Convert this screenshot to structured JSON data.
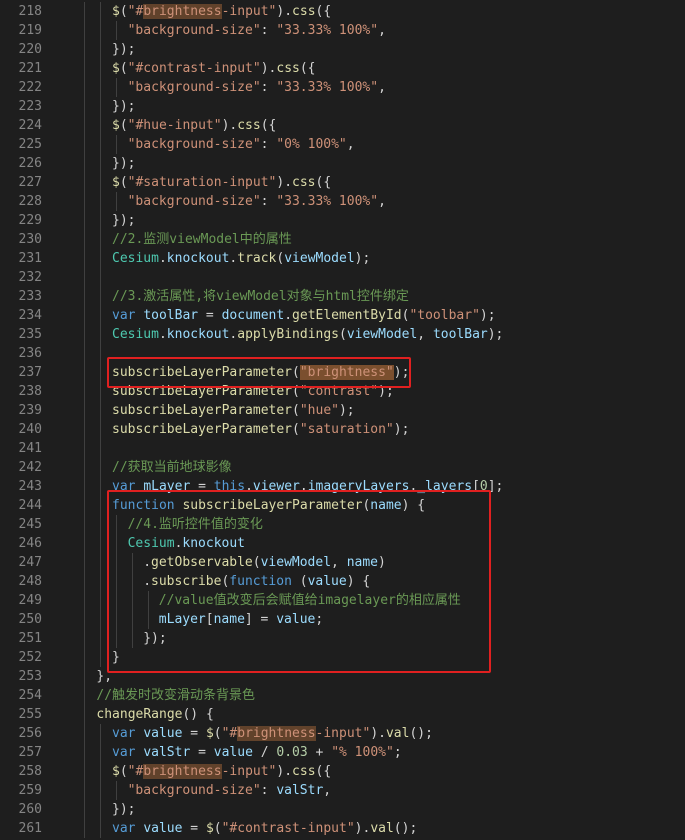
{
  "editor": {
    "lines": [
      {
        "n": "218",
        "d": 2,
        "t": [
          [
            "$",
            "fn"
          ],
          [
            "(",
            "pn"
          ],
          [
            "\"#",
            "str"
          ],
          [
            "brightness",
            "strhl"
          ],
          [
            "-input\"",
            "str"
          ],
          [
            ").",
            "pn"
          ],
          [
            "css",
            "fn"
          ],
          [
            "({",
            "pn"
          ]
        ]
      },
      {
        "n": "219",
        "d": 3,
        "t": [
          [
            "\"background-size\"",
            "str"
          ],
          [
            ": ",
            "pn"
          ],
          [
            "\"33.33% 100%\"",
            "str"
          ],
          [
            ",",
            "pn"
          ]
        ]
      },
      {
        "n": "220",
        "d": 2,
        "t": [
          [
            "});",
            "pn"
          ]
        ]
      },
      {
        "n": "221",
        "d": 2,
        "t": [
          [
            "$",
            "fn"
          ],
          [
            "(",
            "pn"
          ],
          [
            "\"#contrast-input\"",
            "str"
          ],
          [
            ").",
            "pn"
          ],
          [
            "css",
            "fn"
          ],
          [
            "({",
            "pn"
          ]
        ]
      },
      {
        "n": "222",
        "d": 3,
        "t": [
          [
            "\"background-size\"",
            "str"
          ],
          [
            ": ",
            "pn"
          ],
          [
            "\"33.33% 100%\"",
            "str"
          ],
          [
            ",",
            "pn"
          ]
        ]
      },
      {
        "n": "223",
        "d": 2,
        "t": [
          [
            "});",
            "pn"
          ]
        ]
      },
      {
        "n": "224",
        "d": 2,
        "t": [
          [
            "$",
            "fn"
          ],
          [
            "(",
            "pn"
          ],
          [
            "\"#hue-input\"",
            "str"
          ],
          [
            ").",
            "pn"
          ],
          [
            "css",
            "fn"
          ],
          [
            "({",
            "pn"
          ]
        ]
      },
      {
        "n": "225",
        "d": 3,
        "t": [
          [
            "\"background-size\"",
            "str"
          ],
          [
            ": ",
            "pn"
          ],
          [
            "\"0% 100%\"",
            "str"
          ],
          [
            ",",
            "pn"
          ]
        ]
      },
      {
        "n": "226",
        "d": 2,
        "t": [
          [
            "});",
            "pn"
          ]
        ]
      },
      {
        "n": "227",
        "d": 2,
        "t": [
          [
            "$",
            "fn"
          ],
          [
            "(",
            "pn"
          ],
          [
            "\"#saturation-input\"",
            "str"
          ],
          [
            ").",
            "pn"
          ],
          [
            "css",
            "fn"
          ],
          [
            "({",
            "pn"
          ]
        ]
      },
      {
        "n": "228",
        "d": 3,
        "t": [
          [
            "\"background-size\"",
            "str"
          ],
          [
            ": ",
            "pn"
          ],
          [
            "\"33.33% 100%\"",
            "str"
          ],
          [
            ",",
            "pn"
          ]
        ]
      },
      {
        "n": "229",
        "d": 2,
        "t": [
          [
            "});",
            "pn"
          ]
        ]
      },
      {
        "n": "230",
        "d": 2,
        "t": [
          [
            "//2.监测viewModel中的属性",
            "cm"
          ]
        ]
      },
      {
        "n": "231",
        "d": 2,
        "t": [
          [
            "Cesium",
            "type"
          ],
          [
            ".",
            "pn"
          ],
          [
            "knockout",
            "var"
          ],
          [
            ".",
            "pn"
          ],
          [
            "track",
            "fn"
          ],
          [
            "(",
            "pn"
          ],
          [
            "viewModel",
            "var"
          ],
          [
            ");",
            "pn"
          ]
        ]
      },
      {
        "n": "232",
        "d": 2,
        "t": []
      },
      {
        "n": "233",
        "d": 2,
        "t": [
          [
            "//3.激活属性,将viewModel对象与html控件绑定",
            "cm"
          ]
        ]
      },
      {
        "n": "234",
        "d": 2,
        "t": [
          [
            "var ",
            "kw"
          ],
          [
            "toolBar",
            "var"
          ],
          [
            " = ",
            "pn"
          ],
          [
            "document",
            "var"
          ],
          [
            ".",
            "pn"
          ],
          [
            "getElementById",
            "fn"
          ],
          [
            "(",
            "pn"
          ],
          [
            "\"toolbar\"",
            "str"
          ],
          [
            ");",
            "pn"
          ]
        ]
      },
      {
        "n": "235",
        "d": 2,
        "t": [
          [
            "Cesium",
            "type"
          ],
          [
            ".",
            "pn"
          ],
          [
            "knockout",
            "var"
          ],
          [
            ".",
            "pn"
          ],
          [
            "applyBindings",
            "fn"
          ],
          [
            "(",
            "pn"
          ],
          [
            "viewModel",
            "var"
          ],
          [
            ", ",
            "pn"
          ],
          [
            "toolBar",
            "var"
          ],
          [
            ");",
            "pn"
          ]
        ]
      },
      {
        "n": "236",
        "d": 2,
        "t": []
      },
      {
        "n": "237",
        "d": 2,
        "t": [
          [
            "subscribeLayerParameter",
            "fn"
          ],
          [
            "(",
            "pn"
          ],
          [
            "\"brightness\"",
            "strhl2"
          ],
          [
            ");",
            "pn"
          ]
        ]
      },
      {
        "n": "238",
        "d": 2,
        "t": [
          [
            "subscribeLayerParameter",
            "fn"
          ],
          [
            "(",
            "pn"
          ],
          [
            "\"contrast\"",
            "str"
          ],
          [
            ");",
            "pn"
          ]
        ]
      },
      {
        "n": "239",
        "d": 2,
        "t": [
          [
            "subscribeLayerParameter",
            "fn"
          ],
          [
            "(",
            "pn"
          ],
          [
            "\"hue\"",
            "str"
          ],
          [
            ");",
            "pn"
          ]
        ]
      },
      {
        "n": "240",
        "d": 2,
        "t": [
          [
            "subscribeLayerParameter",
            "fn"
          ],
          [
            "(",
            "pn"
          ],
          [
            "\"saturation\"",
            "str"
          ],
          [
            ");",
            "pn"
          ]
        ]
      },
      {
        "n": "241",
        "d": 2,
        "t": []
      },
      {
        "n": "242",
        "d": 2,
        "t": [
          [
            "//获取当前地球影像",
            "cm"
          ]
        ]
      },
      {
        "n": "243",
        "d": 2,
        "t": [
          [
            "var ",
            "kw"
          ],
          [
            "mLayer",
            "var"
          ],
          [
            " = ",
            "pn"
          ],
          [
            "this",
            "kw"
          ],
          [
            ".",
            "pn"
          ],
          [
            "viewer",
            "var"
          ],
          [
            ".",
            "pn"
          ],
          [
            "imageryLayers",
            "var"
          ],
          [
            ".",
            "pn"
          ],
          [
            "_layers",
            "var"
          ],
          [
            "[",
            "pn"
          ],
          [
            "0",
            "num"
          ],
          [
            "];",
            "pn"
          ]
        ]
      },
      {
        "n": "244",
        "d": 2,
        "t": [
          [
            "function ",
            "kw"
          ],
          [
            "subscribeLayerParameter",
            "fn"
          ],
          [
            "(",
            "pn"
          ],
          [
            "name",
            "var"
          ],
          [
            ") {",
            "pn"
          ]
        ]
      },
      {
        "n": "245",
        "d": 3,
        "t": [
          [
            "//4.监听控件值的变化",
            "cm"
          ]
        ]
      },
      {
        "n": "246",
        "d": 3,
        "t": [
          [
            "Cesium",
            "type"
          ],
          [
            ".",
            "pn"
          ],
          [
            "knockout",
            "var"
          ]
        ]
      },
      {
        "n": "247",
        "d": 4,
        "t": [
          [
            ".",
            "pn"
          ],
          [
            "getObservable",
            "fn"
          ],
          [
            "(",
            "pn"
          ],
          [
            "viewModel",
            "var"
          ],
          [
            ", ",
            "pn"
          ],
          [
            "name",
            "var"
          ],
          [
            ")",
            "pn"
          ]
        ]
      },
      {
        "n": "248",
        "d": 4,
        "t": [
          [
            ".",
            "pn"
          ],
          [
            "subscribe",
            "fn"
          ],
          [
            "(",
            "pn"
          ],
          [
            "function ",
            "kw"
          ],
          [
            "(",
            "pn"
          ],
          [
            "value",
            "var"
          ],
          [
            ") {",
            "pn"
          ]
        ]
      },
      {
        "n": "249",
        "d": 5,
        "t": [
          [
            "//value值改变后会赋值给imagelayer的相应属性",
            "cm"
          ]
        ]
      },
      {
        "n": "250",
        "d": 5,
        "t": [
          [
            "mLayer",
            "var"
          ],
          [
            "[",
            "pn"
          ],
          [
            "name",
            "var"
          ],
          [
            "] = ",
            "pn"
          ],
          [
            "value",
            "var"
          ],
          [
            ";",
            "pn"
          ]
        ]
      },
      {
        "n": "251",
        "d": 4,
        "t": [
          [
            "});",
            "pn"
          ]
        ]
      },
      {
        "n": "252",
        "d": 2,
        "t": [
          [
            "}",
            "pn"
          ]
        ]
      },
      {
        "n": "253",
        "d": 1,
        "t": [
          [
            "},",
            "pn"
          ]
        ]
      },
      {
        "n": "254",
        "d": 1,
        "t": [
          [
            "//触发时改变滑动条背景色",
            "cm"
          ]
        ]
      },
      {
        "n": "255",
        "d": 1,
        "t": [
          [
            "changeRange",
            "fn"
          ],
          [
            "() {",
            "pn"
          ]
        ]
      },
      {
        "n": "256",
        "d": 2,
        "t": [
          [
            "var ",
            "kw"
          ],
          [
            "value",
            "var"
          ],
          [
            " = ",
            "pn"
          ],
          [
            "$",
            "fn"
          ],
          [
            "(",
            "pn"
          ],
          [
            "\"#",
            "str"
          ],
          [
            "brightness",
            "strhl"
          ],
          [
            "-input\"",
            "str"
          ],
          [
            ").",
            "pn"
          ],
          [
            "val",
            "fn"
          ],
          [
            "();",
            "pn"
          ]
        ]
      },
      {
        "n": "257",
        "d": 2,
        "t": [
          [
            "var ",
            "kw"
          ],
          [
            "valStr",
            "var"
          ],
          [
            " = ",
            "pn"
          ],
          [
            "value",
            "var"
          ],
          [
            " / ",
            "pn"
          ],
          [
            "0.03",
            "num"
          ],
          [
            " + ",
            "pn"
          ],
          [
            "\"% 100%\"",
            "str"
          ],
          [
            ";",
            "pn"
          ]
        ]
      },
      {
        "n": "258",
        "d": 2,
        "t": [
          [
            "$",
            "fn"
          ],
          [
            "(",
            "pn"
          ],
          [
            "\"#",
            "str"
          ],
          [
            "brightness",
            "strhl"
          ],
          [
            "-input\"",
            "str"
          ],
          [
            ").",
            "pn"
          ],
          [
            "css",
            "fn"
          ],
          [
            "({",
            "pn"
          ]
        ]
      },
      {
        "n": "259",
        "d": 3,
        "t": [
          [
            "\"background-size\"",
            "str"
          ],
          [
            ": ",
            "pn"
          ],
          [
            "valStr",
            "var"
          ],
          [
            ",",
            "pn"
          ]
        ]
      },
      {
        "n": "260",
        "d": 2,
        "t": [
          [
            "});",
            "pn"
          ]
        ]
      },
      {
        "n": "261",
        "d": 2,
        "t": [
          [
            "var ",
            "kw"
          ],
          [
            "value",
            "var"
          ],
          [
            " = ",
            "pn"
          ],
          [
            "$",
            "fn"
          ],
          [
            "(",
            "pn"
          ],
          [
            "\"#contrast-input\"",
            "str"
          ],
          [
            ").",
            "pn"
          ],
          [
            "val",
            "fn"
          ],
          [
            "();",
            "pn"
          ]
        ]
      }
    ]
  },
  "colors": {
    "background": "#1e1e1e",
    "line_number": "#858585",
    "keyword": "#569cd6",
    "string": "#ce9178",
    "variable": "#9cdcfe",
    "function": "#dcdcaa",
    "type": "#4ec9b0",
    "number": "#b5cea8",
    "comment": "#6a9955",
    "highlight_box": "#e02020"
  }
}
